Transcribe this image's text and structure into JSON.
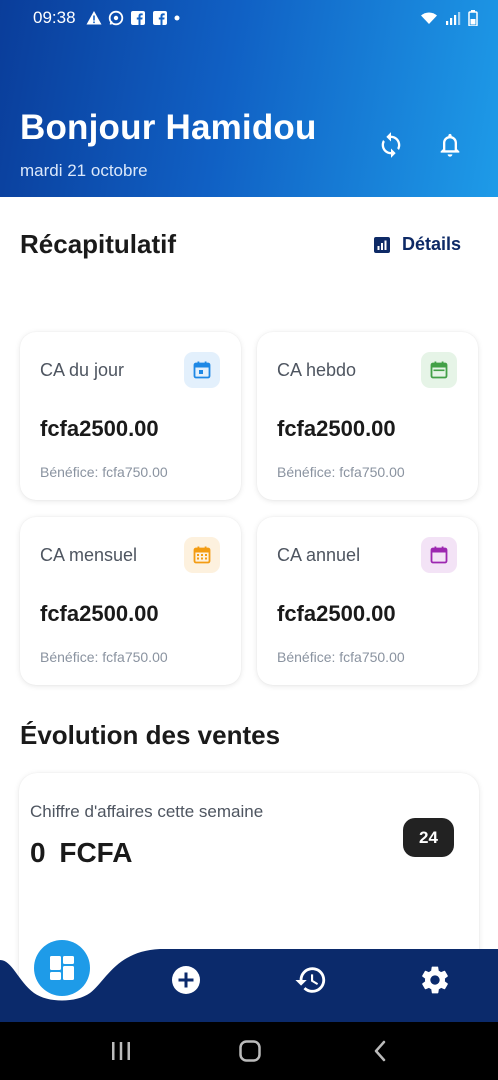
{
  "status_bar": {
    "time": "09:38"
  },
  "header": {
    "greeting": "Bonjour Hamidou",
    "date": "mardi 21 octobre",
    "refresh_icon": "refresh-icon",
    "bell_icon": "bell-icon"
  },
  "summary": {
    "title": "Récapitulatif",
    "details_label": "Détails",
    "cards": [
      {
        "label": "CA du jour",
        "value": "fcfa2500.00",
        "profit": "Bénéfice: fcfa750.00",
        "icon": "calendar-day-icon",
        "accent": "#1e88e5",
        "tint": "#e3f0fc"
      },
      {
        "label": "CA hebdo",
        "value": "fcfa2500.00",
        "profit": "Bénéfice: fcfa750.00",
        "icon": "calendar-week-icon",
        "accent": "#43a047",
        "tint": "#e6f4e7"
      },
      {
        "label": "CA mensuel",
        "value": "fcfa2500.00",
        "profit": "Bénéfice: fcfa750.00",
        "icon": "calendar-month-icon",
        "accent": "#f39c12",
        "tint": "#fdf1de"
      },
      {
        "label": "CA annuel",
        "value": "fcfa2500.00",
        "profit": "Bénéfice: fcfa750.00",
        "icon": "calendar-year-icon",
        "accent": "#9c27b0",
        "tint": "#f3e3f6"
      }
    ]
  },
  "sales": {
    "title": "Évolution des ventes",
    "label": "Chiffre d'affaires cette semaine",
    "value": "0  FCFA",
    "badge": "24"
  },
  "colors": {
    "nav": "#0b2a6b",
    "home": "#1e9be8",
    "header_start": "#0a3d9a",
    "header_end": "#1e9be8"
  }
}
